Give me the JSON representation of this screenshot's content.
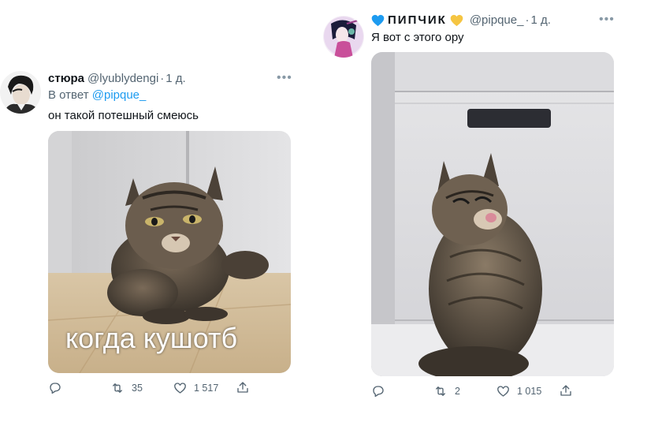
{
  "left_tweet": {
    "name": "стюра",
    "handle": "@lyublydengi",
    "separator": "·",
    "time": "1 д.",
    "reply_prefix": "В ответ",
    "reply_mention": "@pipque_",
    "text": "он такой потешный смеюсь",
    "image_caption": "когда кушотб",
    "retweets": "35",
    "likes": "1 517"
  },
  "right_tweet": {
    "name": "ПИПЧИК",
    "name_emoji_left": "blue-heart-icon",
    "name_emoji_right": "yellow-heart-icon",
    "handle": "@pipque_",
    "separator": "·",
    "time": "1 д.",
    "text": "Я вот с этого ору",
    "retweets": "2",
    "likes": "1 015"
  },
  "colors": {
    "link": "#1d9bf0",
    "secondary_text": "#536471",
    "primary_text": "#0f1419",
    "blue_heart": "#1d9bf0",
    "yellow_heart": "#f5c542"
  }
}
